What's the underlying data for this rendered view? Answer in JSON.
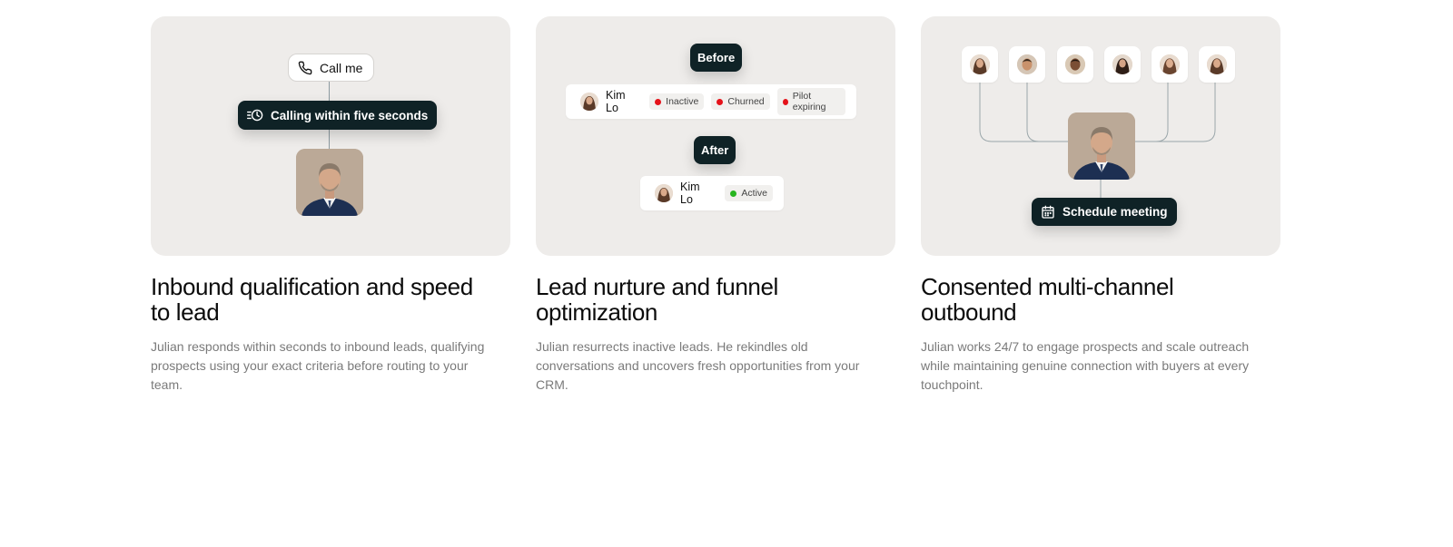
{
  "cards": [
    {
      "title": "Inbound qualification and speed to lead",
      "description": "Julian responds within seconds to inbound leads, qualifying prospects using your exact criteria before routing to your team.",
      "call_label": "Call me",
      "calling_label": "Calling within five seconds"
    },
    {
      "title": "Lead nurture and funnel optimization",
      "description": "Julian resurrects inactive leads. He rekindles old conversations and uncovers fresh opportunities from your CRM.",
      "before_label": "Before",
      "after_label": "After",
      "contact_name": "Kim Lo",
      "before_tags": [
        "Inactive",
        "Churned",
        "Pilot expiring"
      ],
      "after_tag": "Active"
    },
    {
      "title": "Consented multi-channel outbound",
      "description": "Julian works 24/7 to engage prospects and scale outreach while maintaining genuine connection with buyers at every touchpoint.",
      "schedule_label": "Schedule meeting"
    }
  ],
  "colors": {
    "panel_bg": "#eeecea",
    "dark_pill": "#0f2226",
    "status_red": "#e5121a",
    "status_green": "#27b51f",
    "description_text": "#7a7a7a"
  }
}
